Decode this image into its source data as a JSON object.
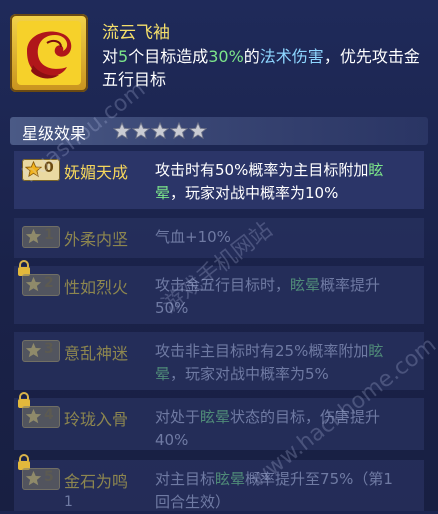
{
  "skill": {
    "name": "流云飞袖",
    "desc_parts": [
      "对",
      "5",
      "个目标造成",
      "30%",
      "的",
      "法术伤害",
      "，优先攻击金五行目标"
    ]
  },
  "stars": {
    "title": "星级效果",
    "count": 5,
    "filled": 5,
    "color": "#c9cbd3"
  },
  "effects": [
    {
      "rank": "0",
      "name": "妩媚天成",
      "locked": false,
      "desc_parts": [
        "攻击时有50%概率为主目标附加",
        "眩晕",
        "，玩家对战中概率为10%"
      ]
    },
    {
      "rank": "1",
      "name": "外柔内坚",
      "locked": true,
      "desc_parts": [
        "气血+10%",
        "",
        ""
      ]
    },
    {
      "rank": "2",
      "name": "性如烈火",
      "locked": true,
      "desc_parts": [
        "攻击金五行目标时，",
        "眩晕",
        "概率提升50%"
      ]
    },
    {
      "rank": "3",
      "name": "意乱神迷",
      "locked": true,
      "desc_parts": [
        "攻击非主目标时有25%概率附加",
        "眩晕",
        "，玩家对战中概率为5%"
      ]
    },
    {
      "rank": "4",
      "name": "玲珑入骨",
      "locked": true,
      "desc_parts": [
        "对处于",
        "眩晕",
        "状态的目标，伤害提升40%"
      ]
    },
    {
      "rank": "5",
      "name": "金石为鸣",
      "locked": true,
      "sub": "1",
      "desc_parts": [
        "对主目标",
        "眩晕",
        "概率提升至75%（第1回合生效）"
      ]
    }
  ],
  "watermark": {
    "a": "huashou.com",
    "b": "游戏手机网站",
    "c": "www.hackhome.com"
  }
}
